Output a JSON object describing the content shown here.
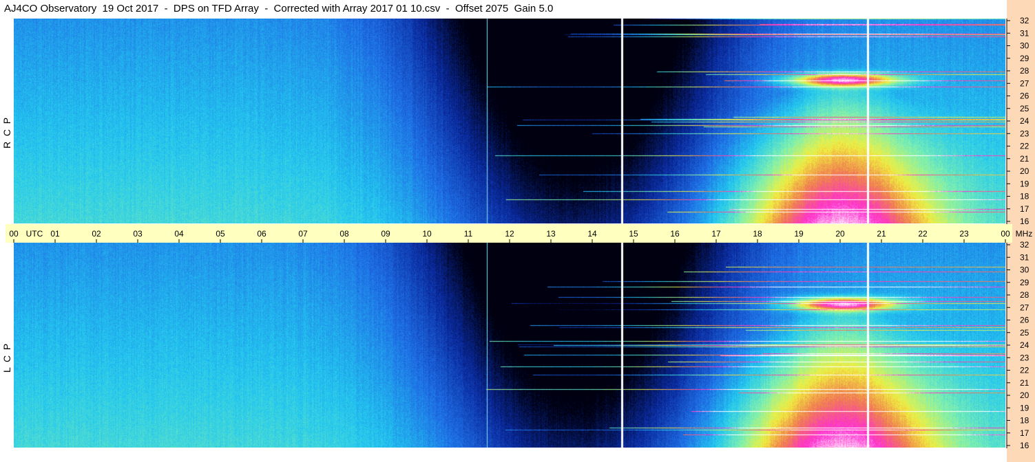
{
  "title": "AJ4CO Observatory  19 Oct 2017  -  DPS on TFD Array  -  Corrected with Array 2017 01 10.csv  -  Offset 2075  Gain 5.0",
  "chart_data": [
    {
      "type": "heatmap",
      "panel": "top",
      "side_label": "R  C  P",
      "x_axis": {
        "unit": "UTC",
        "ticks": [
          "00",
          "01",
          "02",
          "03",
          "04",
          "05",
          "06",
          "07",
          "08",
          "09",
          "10",
          "11",
          "12",
          "13",
          "14",
          "15",
          "16",
          "17",
          "18",
          "19",
          "20",
          "21",
          "22",
          "23",
          "00"
        ],
        "xlim": [
          0,
          24
        ]
      },
      "y_axis": {
        "unit": "MHz",
        "ticks": [
          "32",
          "31",
          "30",
          "29",
          "28",
          "27",
          "26",
          "25",
          "24",
          "23",
          "22",
          "21",
          "20",
          "19",
          "18",
          "17",
          "16"
        ],
        "ylim": [
          16,
          32
        ]
      },
      "colormap": [
        "#000010",
        "#0a2a9e",
        "#1f6fe6",
        "#23c8f0",
        "#7ef0b0",
        "#f0f040",
        "#f07f4f",
        "#ff2fd0",
        "#ffffff"
      ],
      "vertical_lines_utc": [
        11.45,
        14.7,
        20.65
      ]
    },
    {
      "type": "heatmap",
      "panel": "bottom",
      "side_label": "L  C  P",
      "x_axis": {
        "unit": "UTC",
        "ticks": [
          "00",
          "01",
          "02",
          "03",
          "04",
          "05",
          "06",
          "07",
          "08",
          "09",
          "10",
          "11",
          "12",
          "13",
          "14",
          "15",
          "16",
          "17",
          "18",
          "19",
          "20",
          "21",
          "22",
          "23",
          "00"
        ],
        "xlim": [
          0,
          24
        ]
      },
      "y_axis": {
        "unit": "MHz",
        "ticks": [
          "32",
          "31",
          "30",
          "29",
          "28",
          "27",
          "26",
          "25",
          "24",
          "23",
          "22",
          "21",
          "20",
          "19",
          "18",
          "17",
          "16"
        ],
        "ylim": [
          16,
          32
        ]
      },
      "colormap": [
        "#000010",
        "#0a2a9e",
        "#1f6fe6",
        "#23c8f0",
        "#7ef0b0",
        "#f0f040",
        "#f07f4f",
        "#ff2fd0",
        "#ffffff"
      ],
      "vertical_lines_utc": [
        11.45,
        14.7,
        20.65
      ]
    }
  ],
  "axis_labels": {
    "utc": "UTC",
    "mhz": "MHz"
  }
}
